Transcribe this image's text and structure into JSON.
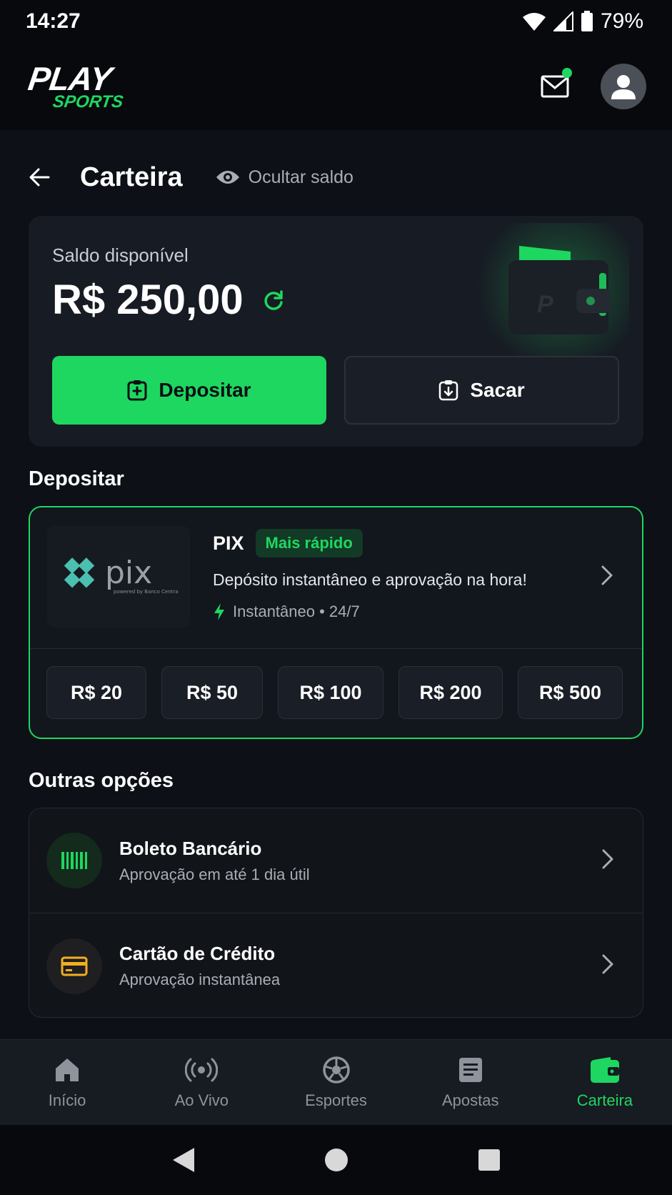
{
  "status_bar": {
    "time": "14:27",
    "battery": "79%"
  },
  "header": {
    "logo_top": "PLAY",
    "logo_bottom": "SPORTS"
  },
  "page": {
    "title": "Carteira",
    "hide_balance_label": "Ocultar saldo"
  },
  "balance": {
    "label": "Saldo disponível",
    "value": "R$ 250,00",
    "deposit_label": "Depositar",
    "withdraw_label": "Sacar"
  },
  "deposit_section": {
    "title": "Depositar",
    "pix": {
      "name": "PIX",
      "badge": "Mais rápido",
      "description": "Depósito instantâneo e aprovação na hora!",
      "meta": "Instantâneo • 24/7",
      "logo_text": "pix",
      "logo_sub": "powered by Banco Central"
    },
    "amounts": [
      "R$ 20",
      "R$ 50",
      "R$ 100",
      "R$ 200",
      "R$ 500"
    ]
  },
  "other_options": {
    "title": "Outras opções",
    "items": [
      {
        "title": "Boleto Bancário",
        "subtitle": "Aprovação em até 1 dia útil",
        "icon": "barcode-icon"
      },
      {
        "title": "Cartão de Crédito",
        "subtitle": "Aprovação instantânea",
        "icon": "credit-card-icon"
      }
    ]
  },
  "bottom_nav": {
    "items": [
      {
        "label": "Início",
        "icon": "home-icon"
      },
      {
        "label": "Ao Vivo",
        "icon": "live-icon"
      },
      {
        "label": "Esportes",
        "icon": "ball-icon"
      },
      {
        "label": "Apostas",
        "icon": "bets-icon"
      },
      {
        "label": "Carteira",
        "icon": "wallet-icon"
      }
    ],
    "active": "Carteira"
  },
  "colors": {
    "accent": "#1ed760",
    "background": "#0d1016",
    "card": "#171b23",
    "warning": "#f2b01e"
  }
}
